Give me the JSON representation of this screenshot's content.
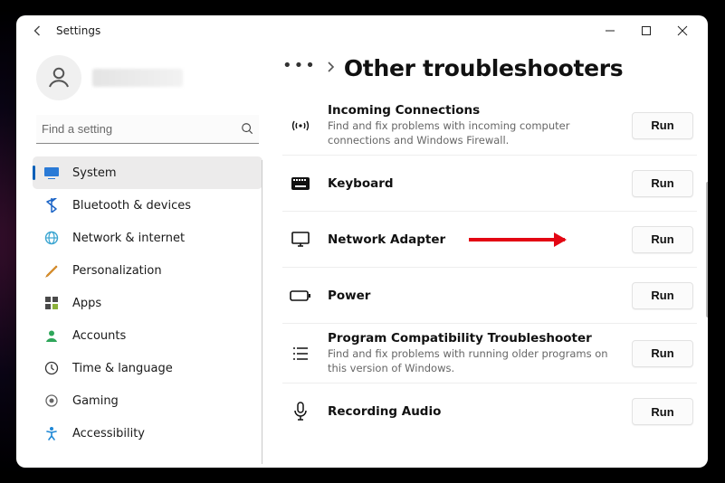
{
  "window": {
    "app_title": "Settings"
  },
  "search": {
    "placeholder": "Find a setting"
  },
  "sidebar": {
    "items": [
      {
        "id": "system",
        "label": "System",
        "active": true
      },
      {
        "id": "bluetooth",
        "label": "Bluetooth & devices",
        "active": false
      },
      {
        "id": "network",
        "label": "Network & internet",
        "active": false
      },
      {
        "id": "personalization",
        "label": "Personalization",
        "active": false
      },
      {
        "id": "apps",
        "label": "Apps",
        "active": false
      },
      {
        "id": "accounts",
        "label": "Accounts",
        "active": false
      },
      {
        "id": "time",
        "label": "Time & language",
        "active": false
      },
      {
        "id": "gaming",
        "label": "Gaming",
        "active": false
      },
      {
        "id": "accessibility",
        "label": "Accessibility",
        "active": false
      }
    ]
  },
  "breadcrumb": {
    "overflow": "…",
    "title": "Other troubleshooters"
  },
  "troubleshooters": [
    {
      "id": "incoming",
      "title": "Incoming Connections",
      "desc": "Find and fix problems with incoming computer connections and Windows Firewall.",
      "run": "Run",
      "highlight": false
    },
    {
      "id": "keyboard",
      "title": "Keyboard",
      "desc": "",
      "run": "Run",
      "highlight": false
    },
    {
      "id": "netadapter",
      "title": "Network Adapter",
      "desc": "",
      "run": "Run",
      "highlight": true
    },
    {
      "id": "power",
      "title": "Power",
      "desc": "",
      "run": "Run",
      "highlight": false
    },
    {
      "id": "progcompat",
      "title": "Program Compatibility Troubleshooter",
      "desc": "Find and fix problems with running older programs on this version of Windows.",
      "run": "Run",
      "highlight": false
    },
    {
      "id": "recaudio",
      "title": "Recording Audio",
      "desc": "",
      "run": "Run",
      "highlight": false
    }
  ],
  "colors": {
    "accent": "#005fb8",
    "annotation": "#e30613"
  }
}
